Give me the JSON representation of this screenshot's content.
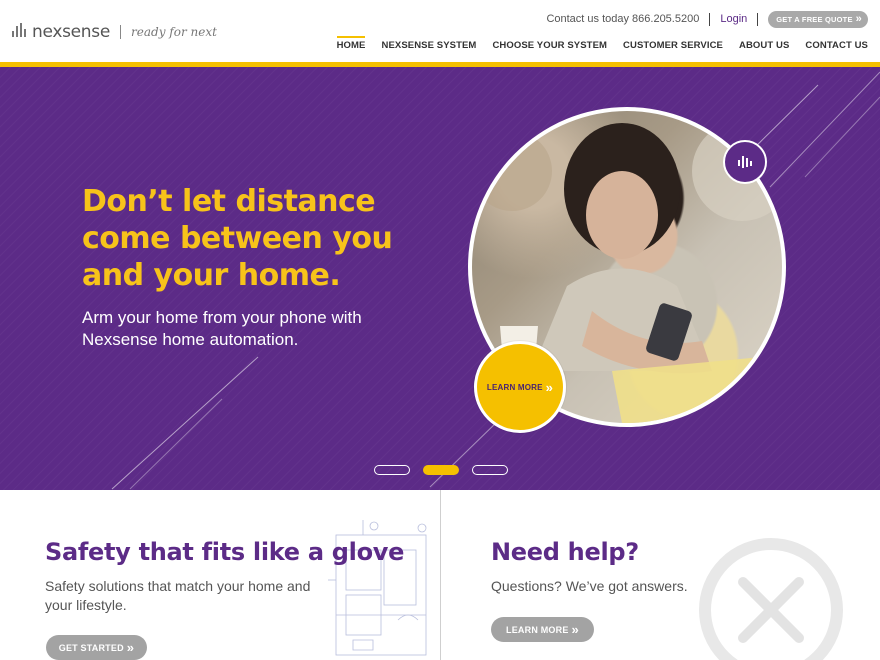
{
  "brand": {
    "name": "nexsense",
    "tagline": "ready for next"
  },
  "topbar": {
    "contact": "Contact us today 866.205.5200",
    "login": "Login",
    "quote": "GET A FREE QUOTE"
  },
  "nav": {
    "items": [
      "HOME",
      "NEXSENSE SYSTEM",
      "CHOOSE YOUR SYSTEM",
      "CUSTOMER SERVICE",
      "ABOUT US",
      "CONTACT US"
    ],
    "active": "HOME"
  },
  "hero": {
    "title_lines": [
      "Don’t let distance",
      "come between you",
      "and your home."
    ],
    "subtitle_lines": [
      "Arm your home from your phone with",
      "Nexsense home automation."
    ],
    "cta": "LEARN MORE",
    "slides": {
      "count": 3,
      "active_index": 1
    }
  },
  "panels": {
    "left": {
      "title": "Safety that fits like a glove",
      "text_lines": [
        "Safety solutions that match your home and",
        "your lifestyle."
      ],
      "button": "GET STARTED"
    },
    "right": {
      "title": "Need help?",
      "text": "Questions? We’ve got answers.",
      "button": "LEARN MORE"
    }
  },
  "icons": {
    "logo": "signal-bars-icon",
    "quote_chevron": "double-chevron-right-icon",
    "hero_badge": "signal-bars-icon",
    "help_illustration": "wrench-screwdriver-icon"
  },
  "colors": {
    "purple": "#5c2b87",
    "yellow": "#f5c000",
    "grey_button": "#a3a3a3"
  }
}
